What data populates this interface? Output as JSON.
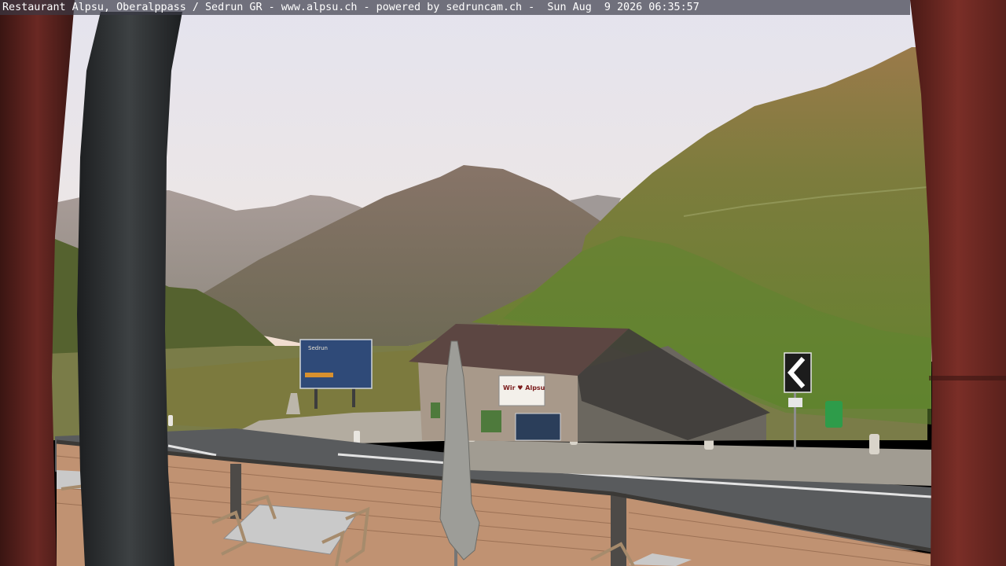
{
  "overlay": {
    "caption": "Restaurant Alpsu, Oberalppass / Sedrun GR - www.alpsu.ch - powered by sedruncam.ch -  Sun Aug  9 2026 06:35:57"
  },
  "scene": {
    "billboard_text": "Sedrun",
    "banner_text": "Wir ♥ Alpsu",
    "colors": {
      "sky_top": "#e6e4ee",
      "sky_bottom": "#f0e2d6",
      "grass": "#6f8a3c",
      "frame_wood": "#6e2a25"
    }
  }
}
